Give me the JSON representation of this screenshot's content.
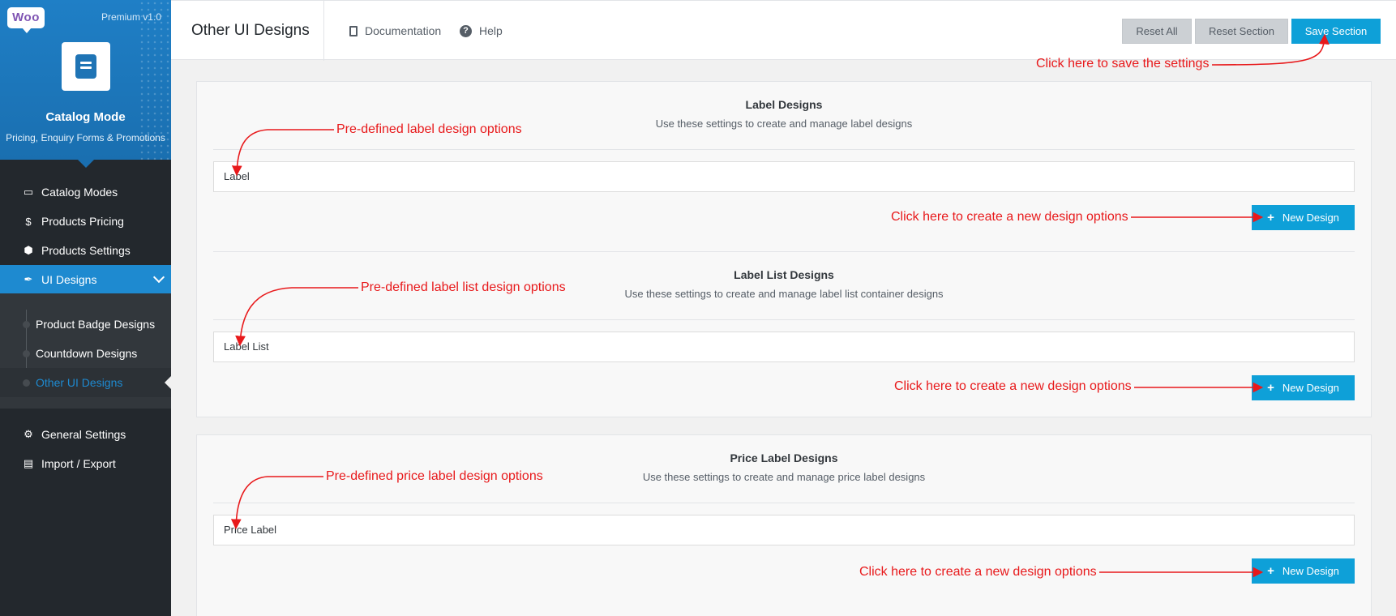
{
  "sidebar": {
    "logo_text": "Woo",
    "version": "Premium v1.0",
    "app_title": "Catalog Mode",
    "app_subtitle": "Pricing, Enquiry Forms & Promotions",
    "items": [
      {
        "label": "Catalog Modes",
        "icon": "book-icon"
      },
      {
        "label": "Products Pricing",
        "icon": "dollar-icon"
      },
      {
        "label": "Products Settings",
        "icon": "cube-icon"
      },
      {
        "label": "UI Designs",
        "icon": "brush-icon"
      }
    ],
    "subitems": [
      {
        "label": "Product Badge Designs"
      },
      {
        "label": "Countdown Designs"
      },
      {
        "label": "Other UI Designs"
      }
    ],
    "items_bottom": [
      {
        "label": "General Settings",
        "icon": "gears-icon"
      },
      {
        "label": "Import / Export",
        "icon": "import-export-icon"
      }
    ]
  },
  "header": {
    "title": "Other UI Designs",
    "documentation": "Documentation",
    "help": "Help",
    "reset_all": "Reset All",
    "reset_section": "Reset Section",
    "save_section": "Save Section"
  },
  "sections": [
    {
      "title": "Label Designs",
      "description": "Use these settings to create and manage label designs",
      "field_value": "Label",
      "button": "New Design"
    },
    {
      "title": "Label List Designs",
      "description": "Use these settings to create and manage label list container designs",
      "field_value": "Label List",
      "button": "New Design"
    },
    {
      "title": "Price Label Designs",
      "description": "Use these settings to create and manage price label designs",
      "field_value": "Price Label",
      "button": "New Design"
    }
  ],
  "annotations": {
    "save": "Click here to save the settings",
    "predefined_label": "Pre-defined label design options",
    "predefined_label_list": "Pre-defined label list design options",
    "predefined_price_label": "Pre-defined price label design options",
    "create_new": "Click here to create a new design options"
  },
  "colors": {
    "sidebar_bg": "#23282d",
    "brand_blue": "#1a6fb0",
    "accent": "#0ea0d8",
    "annotation_red": "#e8191b"
  }
}
